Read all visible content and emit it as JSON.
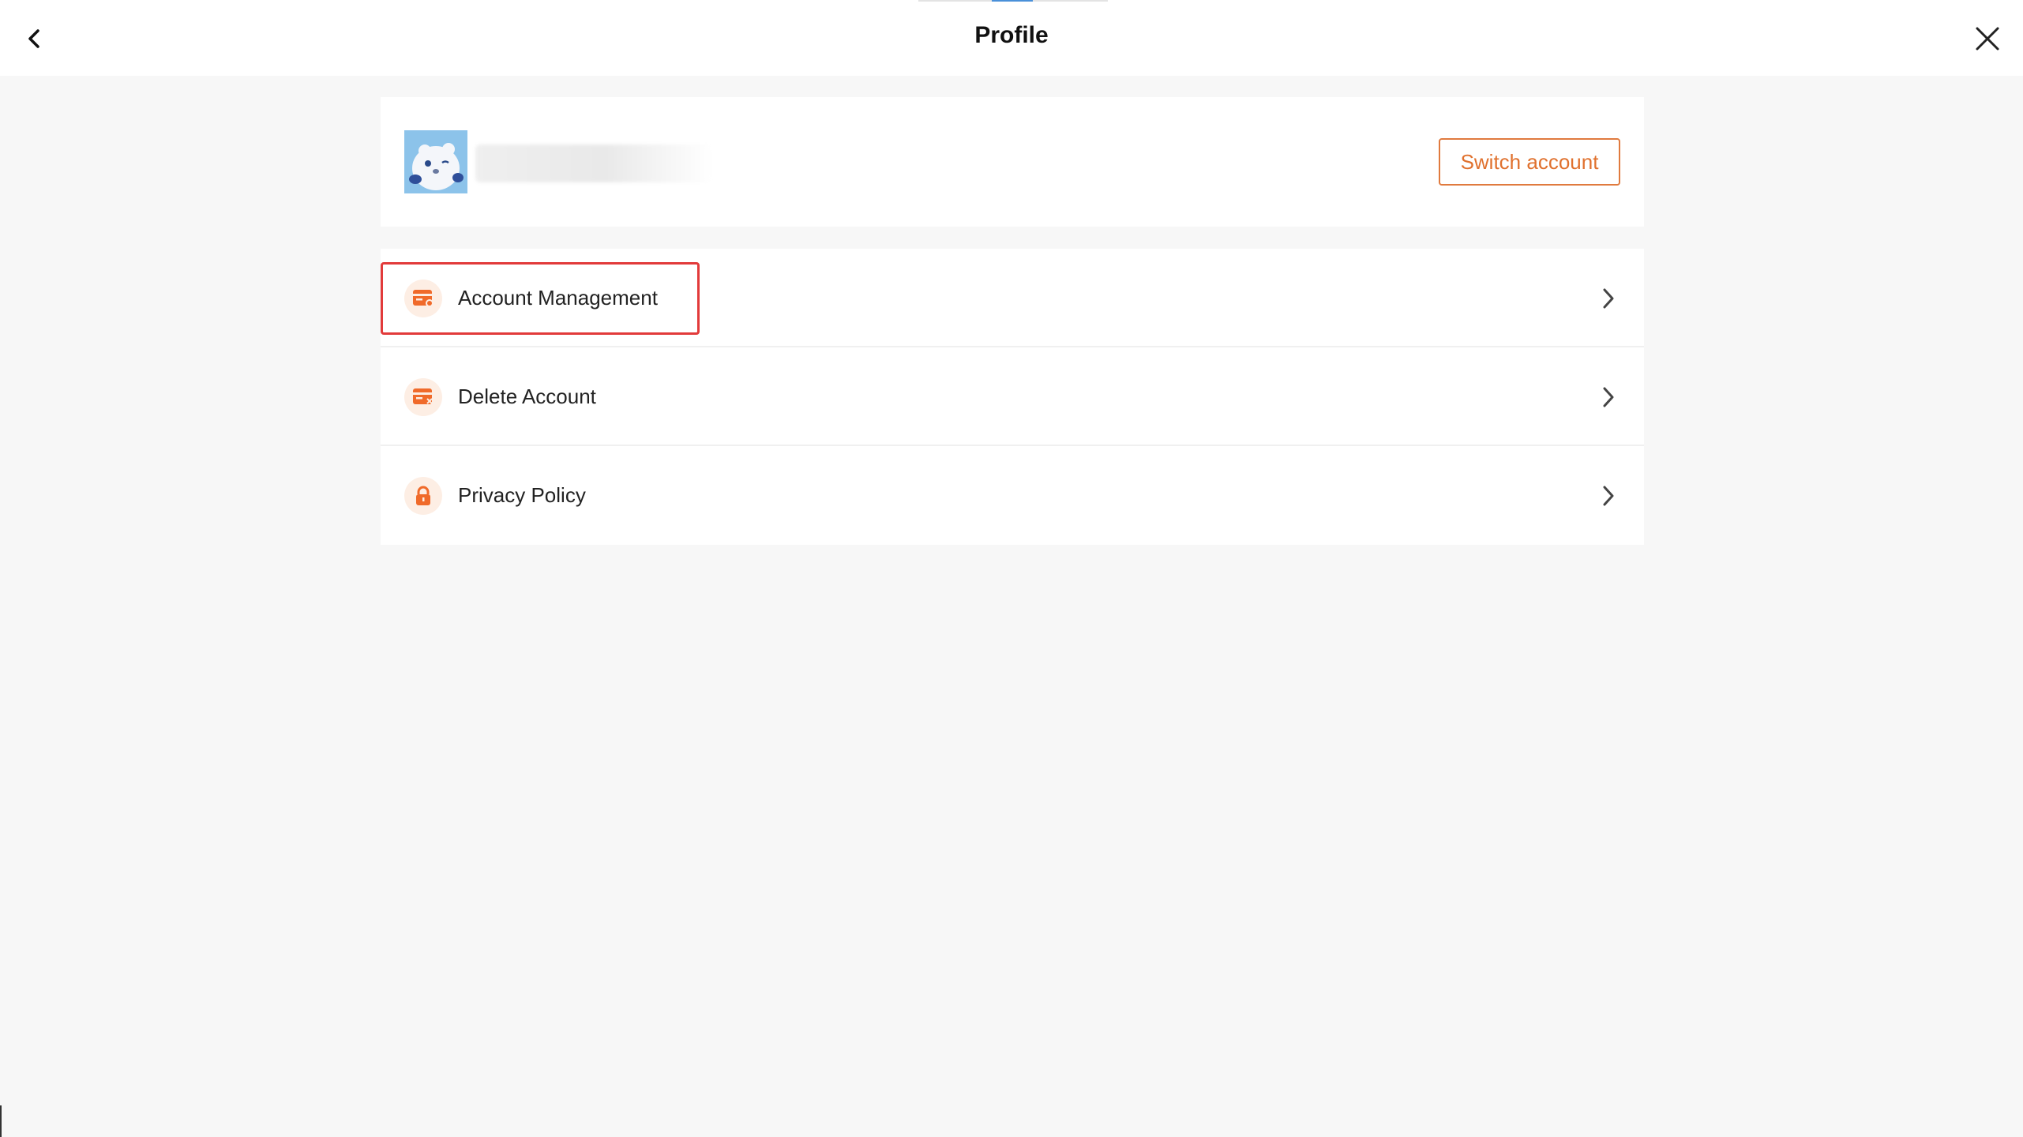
{
  "header": {
    "title": "Profile",
    "back_icon": "chevron-left-icon",
    "close_icon": "close-icon"
  },
  "profile": {
    "switch_label": "Switch account"
  },
  "menu": {
    "items": [
      {
        "label": "Account Management",
        "icon": "card-settings-icon"
      },
      {
        "label": "Delete Account",
        "icon": "card-delete-icon"
      },
      {
        "label": "Privacy Policy",
        "icon": "lock-icon"
      }
    ]
  },
  "colors": {
    "accent": "#e0712e",
    "highlight": "#e23a3a",
    "icon_bg": "#fdeee4"
  }
}
